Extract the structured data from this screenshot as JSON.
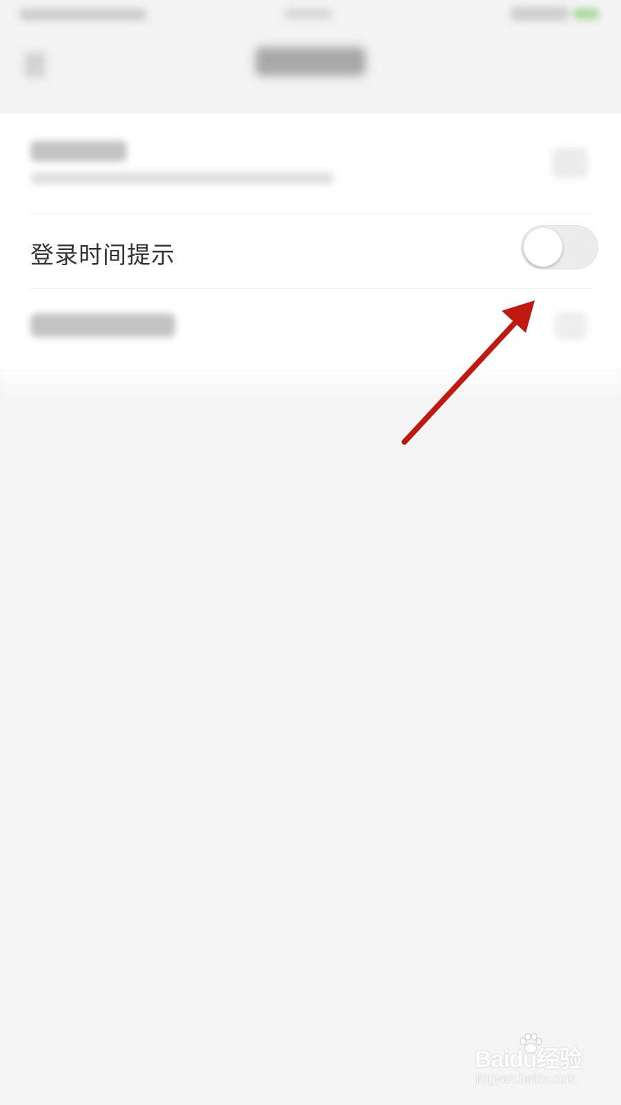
{
  "settings": {
    "login_time_reminder": {
      "label": "登录时间提示",
      "enabled": false
    }
  },
  "annotation": {
    "arrow_color": "#c0190f"
  },
  "watermark": {
    "brand": "Baidu",
    "brand_suffix": "经验",
    "url": "jingyan.baidu.com"
  },
  "colors": {
    "background": "#f5f5f5",
    "card": "#ffffff",
    "toggle_off_track": "#ececec"
  }
}
